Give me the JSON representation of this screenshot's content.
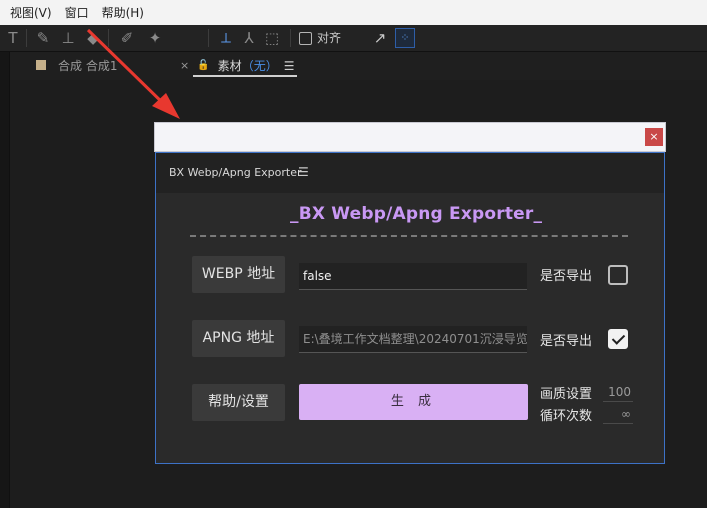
{
  "menubar": {
    "items": [
      "视图(V)",
      "窗口",
      "帮助(H)"
    ]
  },
  "toolbar": {
    "align_label": "对齐",
    "icons": [
      "text-tool-icon",
      "brush-tool-icon",
      "clone-stamp-icon",
      "eraser-icon",
      "roto-brush-icon",
      "puppet-pin-icon",
      "axis-local-icon",
      "axis-world-icon",
      "axis-view-icon",
      "snap-icon",
      "grid-select-icon"
    ]
  },
  "panels": {
    "comp_tab": "合成 合成1",
    "footage_tab": {
      "close": "×",
      "label": "素材",
      "value": "（无）"
    }
  },
  "dialog": {
    "close_label": "×",
    "panel_name": "BX Webp/Apng Exporter",
    "menu_glyph": "☰",
    "heading": "_BX Webp/Apng Exporter_",
    "webp": {
      "button": "WEBP 地址",
      "value": "false",
      "export_label": "是否导出",
      "export_checked": false
    },
    "apng": {
      "button": "APNG 地址",
      "value": "E:\\叠境工作文档整理\\20240701沉浸导览",
      "export_label": "是否导出",
      "export_checked": true
    },
    "help_button": "帮助/设置",
    "generate_button": "生 成",
    "quality": {
      "label": "画质设置",
      "value": "100"
    },
    "loop": {
      "label": "循环次数",
      "value": "∞"
    }
  },
  "colors": {
    "accent": "#d9b0f4",
    "heading": "#c998f4",
    "dialog_border": "#3d72c7",
    "close": "#c94848",
    "arrow": "#e8382f"
  }
}
